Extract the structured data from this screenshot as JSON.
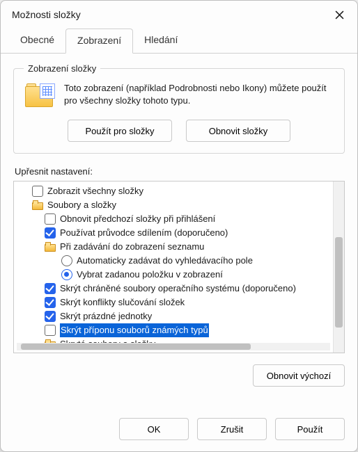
{
  "title": "Možnosti složky",
  "tabs": {
    "general": "Obecné",
    "view": "Zobrazení",
    "search": "Hledání"
  },
  "folderView": {
    "legend": "Zobrazení složky",
    "desc": "Toto zobrazení (například Podrobnosti nebo Ikony) můžete použít pro všechny složky tohoto typu.",
    "apply": "Použít pro složky",
    "reset": "Obnovit složky"
  },
  "advanced": {
    "label": "Upřesnit nastavení:",
    "items": {
      "show_all_folders": "Zobrazit všechny složky",
      "files_and_folders": "Soubory a složky",
      "restore_prev": "Obnovit předchozí složky při přihlášení",
      "use_sharing_wizard": "Používat průvodce sdílením (doporučeno)",
      "when_typing": "Při zadávání do zobrazení seznamu",
      "type_search": "Automaticky zadávat do vyhledávacího pole",
      "type_select": "Vybrat zadanou položku v zobrazení",
      "hide_os_protected": "Skrýt chráněné soubory operačního systému (doporučeno)",
      "hide_merge_conflicts": "Skrýt konflikty slučování složek",
      "hide_empty_drives": "Skrýt prázdné jednotky",
      "hide_known_ext": "Skrýt příponu souborů známých typů",
      "hidden_files": "Skryté soubory a složky"
    }
  },
  "resetDefaults": "Obnovit výchozí",
  "buttons": {
    "ok": "OK",
    "cancel": "Zrušit",
    "apply": "Použít"
  }
}
